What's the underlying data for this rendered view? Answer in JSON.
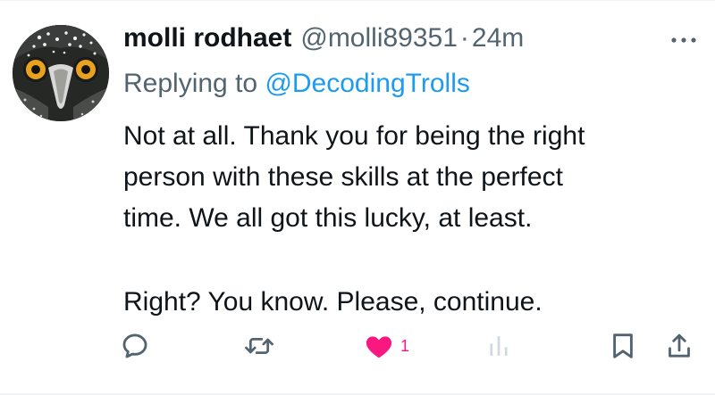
{
  "tweet": {
    "author_name": "molli rodhaet",
    "author_handle": "@molli89351",
    "separator": "·",
    "timestamp": "24m",
    "replying_prefix": "Replying to",
    "replying_to": "@DecodingTrolls",
    "text_lines": [
      "Not at all. Thank you for being the right",
      "person with these skills at the perfect",
      "time. We all got this lucky, at least.",
      "Right? You know. Please, continue."
    ]
  },
  "actions": {
    "reply_icon": "reply-bubble-icon",
    "retweet_icon": "retweet-icon",
    "like_icon": "heart-icon",
    "like_count": "1",
    "like_liked": true,
    "views_icon": "views-bar-chart-icon",
    "bookmark_icon": "bookmark-icon",
    "share_icon": "share-icon"
  },
  "colors": {
    "text": "#0f1419",
    "secondary": "#536471",
    "link": "#1d9bf0",
    "like": "#f91880",
    "divider": "#eff3f4"
  }
}
